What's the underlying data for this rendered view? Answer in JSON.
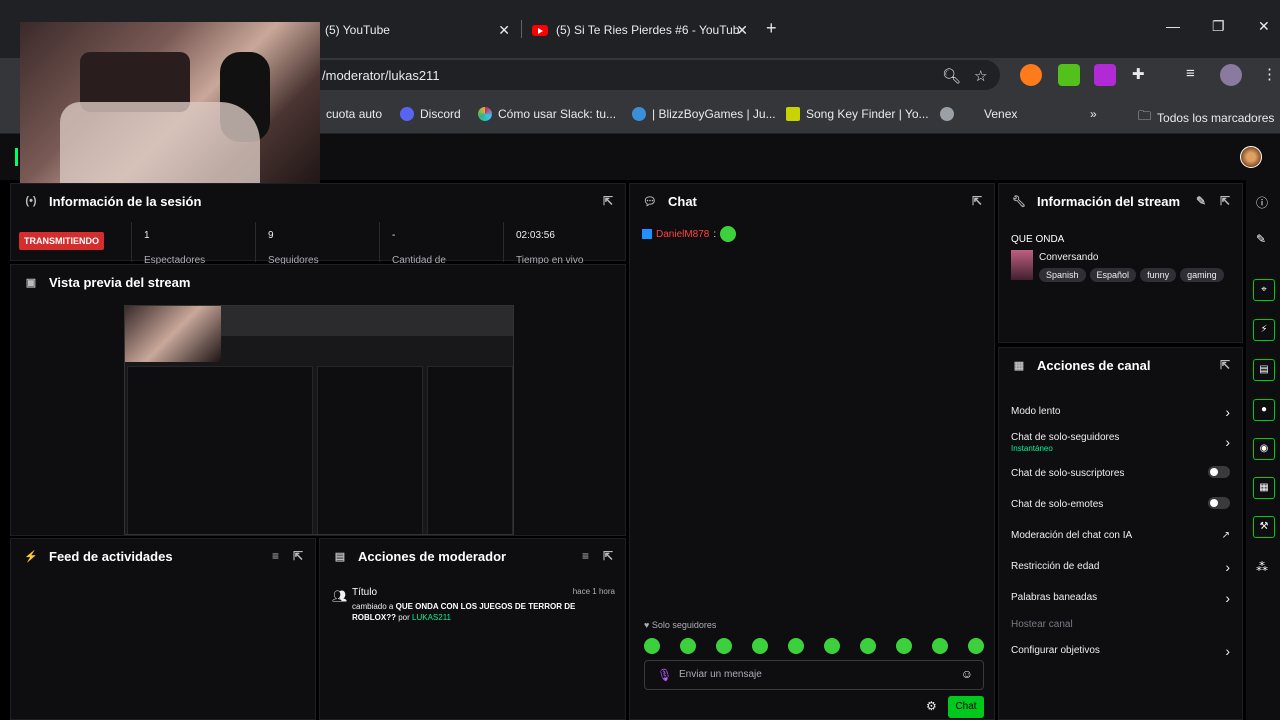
{
  "browser": {
    "tabs": [
      {
        "label": "(5) YouTube"
      },
      {
        "label": "(5) Si Te Ries Pierdes #6 - YouTub"
      }
    ],
    "tab_close": "✕",
    "new_tab": "+",
    "window_controls": {
      "minimize": "—",
      "restore": "❐",
      "close": "✕"
    },
    "url": "/moderator/lukas211",
    "bookmarks": [
      "cuota auto",
      "Discord",
      "Cómo usar Slack: tu...",
      "| BlizzBoyGames | Ju...",
      "Song Key Finder | Yo...",
      "Venex",
      "»",
      "Todos los marcadores"
    ]
  },
  "session": {
    "title": "Información de la sesión",
    "live_badge": "TRANSMITIENDO",
    "stats": [
      {
        "value": "1",
        "label": "Espectadores"
      },
      {
        "value": "9",
        "label": "Seguidores"
      },
      {
        "value": "-",
        "label": "Cantidad de"
      },
      {
        "value": "02:03:56",
        "label": "Tiempo en vivo"
      }
    ]
  },
  "preview": {
    "title": "Vista previa del stream"
  },
  "feed": {
    "title": "Feed de actividades"
  },
  "mod_actions": {
    "title": "Acciones de moderador",
    "entry": {
      "heading": "Título",
      "time": "hace 1 hora",
      "prefix": "cambiado a ",
      "value": "QUE ONDA CON LOS JUEGOS DE TERROR DE ROBLOX??",
      "by": " por ",
      "user": "LUKAS211"
    }
  },
  "chat": {
    "title": "Chat",
    "message": {
      "user": "DanielM878",
      "sep": ":"
    },
    "followers_only": "Solo seguidores",
    "placeholder": "Enviar un mensaje",
    "send_label": "Chat"
  },
  "stream_info": {
    "title": "Información del stream",
    "stream_title": "QUE ONDA",
    "category": "Conversando",
    "tags": [
      "Spanish",
      "Español",
      "funny",
      "gaming"
    ]
  },
  "channel_actions": {
    "title": "Acciones de canal",
    "items": [
      {
        "label": "Modo lento",
        "control": "chevron"
      },
      {
        "label": "Chat de solo-seguidores",
        "sub": "Instantáneo",
        "control": "chevron"
      },
      {
        "label": "Chat de solo-suscriptores",
        "control": "toggle",
        "on": false
      },
      {
        "label": "Chat de solo-emotes",
        "control": "toggle",
        "on": false
      },
      {
        "label": "Moderación del chat con IA",
        "control": "external"
      },
      {
        "label": "Restricción de edad",
        "control": "chevron"
      },
      {
        "label": "Palabras baneadas",
        "control": "chevron"
      },
      {
        "label": "Hostear canal",
        "control": "none",
        "disabled": true
      },
      {
        "label": "Configurar objetivos",
        "control": "chevron"
      }
    ]
  },
  "colors": {
    "accent_green": "#00c91e",
    "live_red": "#d32d2d",
    "panel_bg": "#0e0e10"
  }
}
